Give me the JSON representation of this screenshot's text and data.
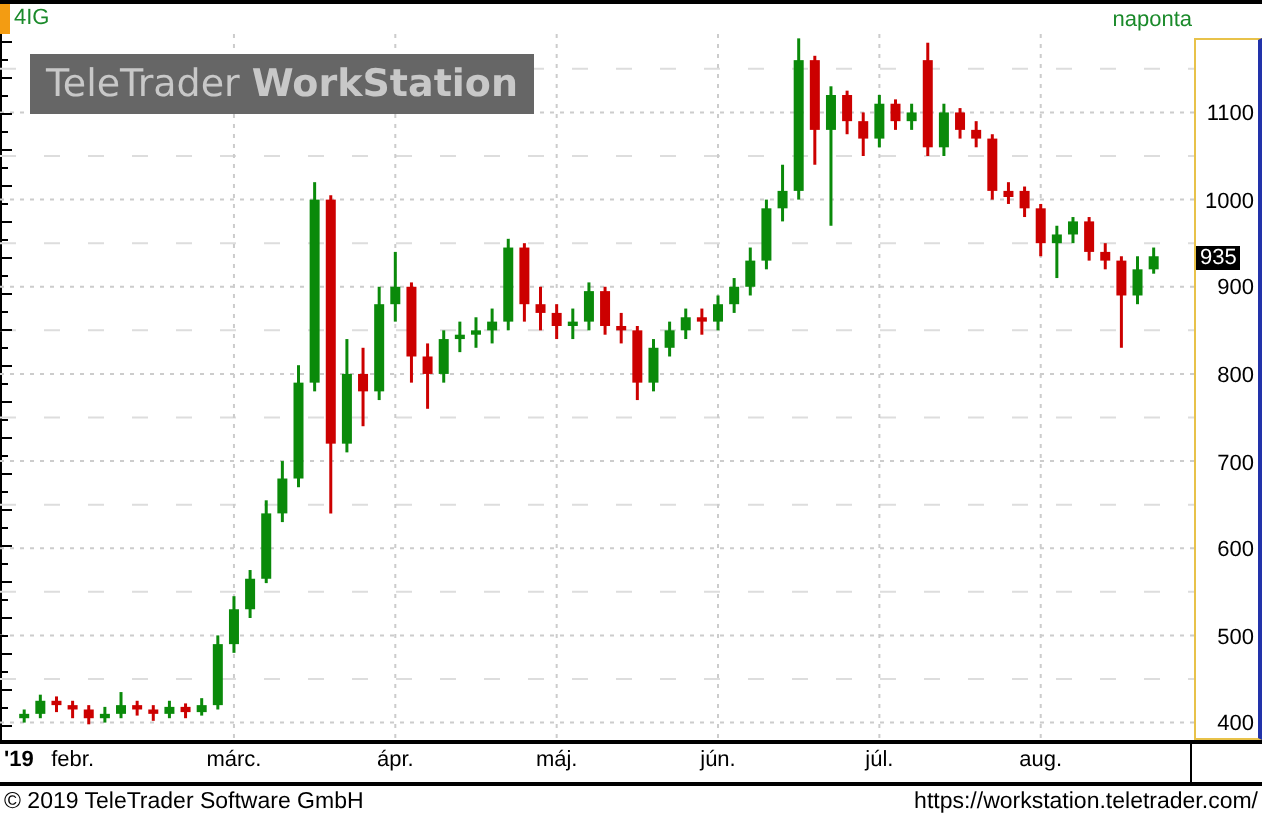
{
  "header": {
    "symbol": "4IG",
    "interval": "naponta"
  },
  "logo": "TeleTrader **WorkStation**",
  "chart": {
    "last_price": "935",
    "year_label": "'19",
    "chart_data": {
      "type": "candlestick",
      "grid": true,
      "ylim": [
        380,
        1190
      ],
      "yticks": [
        400,
        500,
        600,
        700,
        800,
        900,
        1000,
        1100
      ],
      "categories": [
        null,
        null,
        null,
        null,
        "febr.",
        null,
        null,
        null,
        null,
        null,
        null,
        null,
        null,
        null,
        "márc.",
        null,
        null,
        null,
        null,
        null,
        null,
        null,
        null,
        null,
        "ápr.",
        null,
        null,
        null,
        null,
        null,
        null,
        null,
        null,
        null,
        "máj.",
        null,
        null,
        null,
        null,
        null,
        null,
        null,
        null,
        null,
        "jún.",
        null,
        null,
        null,
        null,
        null,
        null,
        null,
        null,
        null,
        "júl.",
        null,
        null,
        null,
        null,
        null,
        null,
        null,
        null,
        null,
        "aug.",
        null,
        null,
        null,
        null,
        null,
        null,
        null,
        null,
        null
      ],
      "ohlc": [
        null,
        [
          405,
          415,
          400,
          410
        ],
        [
          410,
          432,
          405,
          425
        ],
        [
          425,
          430,
          412,
          420
        ],
        [
          420,
          425,
          405,
          415
        ],
        [
          415,
          420,
          398,
          405
        ],
        [
          405,
          418,
          400,
          410
        ],
        [
          410,
          435,
          405,
          420
        ],
        [
          420,
          425,
          408,
          415
        ],
        [
          415,
          420,
          402,
          410
        ],
        [
          410,
          425,
          405,
          418
        ],
        [
          418,
          422,
          405,
          412
        ],
        [
          412,
          428,
          408,
          420
        ],
        [
          420,
          500,
          415,
          490
        ],
        [
          490,
          545,
          480,
          530
        ],
        [
          530,
          575,
          520,
          565
        ],
        [
          565,
          655,
          560,
          640
        ],
        [
          640,
          700,
          630,
          680
        ],
        [
          680,
          810,
          670,
          790
        ],
        [
          790,
          1020,
          780,
          1000
        ],
        [
          1000,
          1005,
          640,
          720
        ],
        [
          720,
          840,
          710,
          800
        ],
        [
          800,
          830,
          740,
          780
        ],
        [
          780,
          900,
          770,
          880
        ],
        [
          880,
          940,
          860,
          900
        ],
        [
          900,
          905,
          790,
          820
        ],
        [
          820,
          835,
          760,
          800
        ],
        [
          800,
          850,
          790,
          840
        ],
        [
          840,
          860,
          825,
          845
        ],
        [
          845,
          865,
          830,
          850
        ],
        [
          850,
          875,
          835,
          860
        ],
        [
          860,
          955,
          850,
          945
        ],
        [
          945,
          950,
          860,
          880
        ],
        [
          880,
          900,
          850,
          870
        ],
        [
          870,
          880,
          840,
          855
        ],
        [
          855,
          875,
          840,
          860
        ],
        [
          860,
          905,
          850,
          895
        ],
        [
          895,
          900,
          845,
          855
        ],
        [
          855,
          870,
          835,
          850
        ],
        [
          850,
          855,
          770,
          790
        ],
        [
          790,
          840,
          780,
          830
        ],
        [
          830,
          860,
          820,
          850
        ],
        [
          850,
          875,
          840,
          865
        ],
        [
          865,
          875,
          845,
          860
        ],
        [
          860,
          890,
          850,
          880
        ],
        [
          880,
          910,
          870,
          900
        ],
        [
          900,
          945,
          890,
          930
        ],
        [
          930,
          1000,
          920,
          990
        ],
        [
          990,
          1040,
          975,
          1010
        ],
        [
          1010,
          1185,
          1000,
          1160
        ],
        [
          1160,
          1165,
          1040,
          1080
        ],
        [
          1080,
          1130,
          970,
          1120
        ],
        [
          1120,
          1125,
          1075,
          1090
        ],
        [
          1090,
          1100,
          1050,
          1070
        ],
        [
          1070,
          1120,
          1060,
          1110
        ],
        [
          1110,
          1115,
          1080,
          1090
        ],
        [
          1090,
          1110,
          1080,
          1100
        ],
        [
          1160,
          1180,
          1050,
          1060
        ],
        [
          1060,
          1110,
          1050,
          1100
        ],
        [
          1100,
          1105,
          1070,
          1080
        ],
        [
          1080,
          1090,
          1060,
          1070
        ],
        [
          1070,
          1075,
          1000,
          1010
        ],
        [
          1010,
          1020,
          995,
          1003
        ],
        [
          1010,
          1015,
          980,
          990
        ],
        [
          990,
          995,
          935,
          950
        ],
        [
          950,
          970,
          910,
          960
        ],
        [
          960,
          980,
          950,
          975
        ],
        [
          975,
          980,
          930,
          940
        ],
        [
          940,
          950,
          920,
          930
        ],
        [
          930,
          935,
          830,
          890
        ],
        [
          890,
          935,
          880,
          920
        ],
        [
          920,
          945,
          915,
          935
        ],
        null,
        null
      ]
    }
  },
  "footer": {
    "copyright": "© 2019 TeleTrader Software GmbH",
    "url": "https://workstation.teletrader.com/"
  }
}
